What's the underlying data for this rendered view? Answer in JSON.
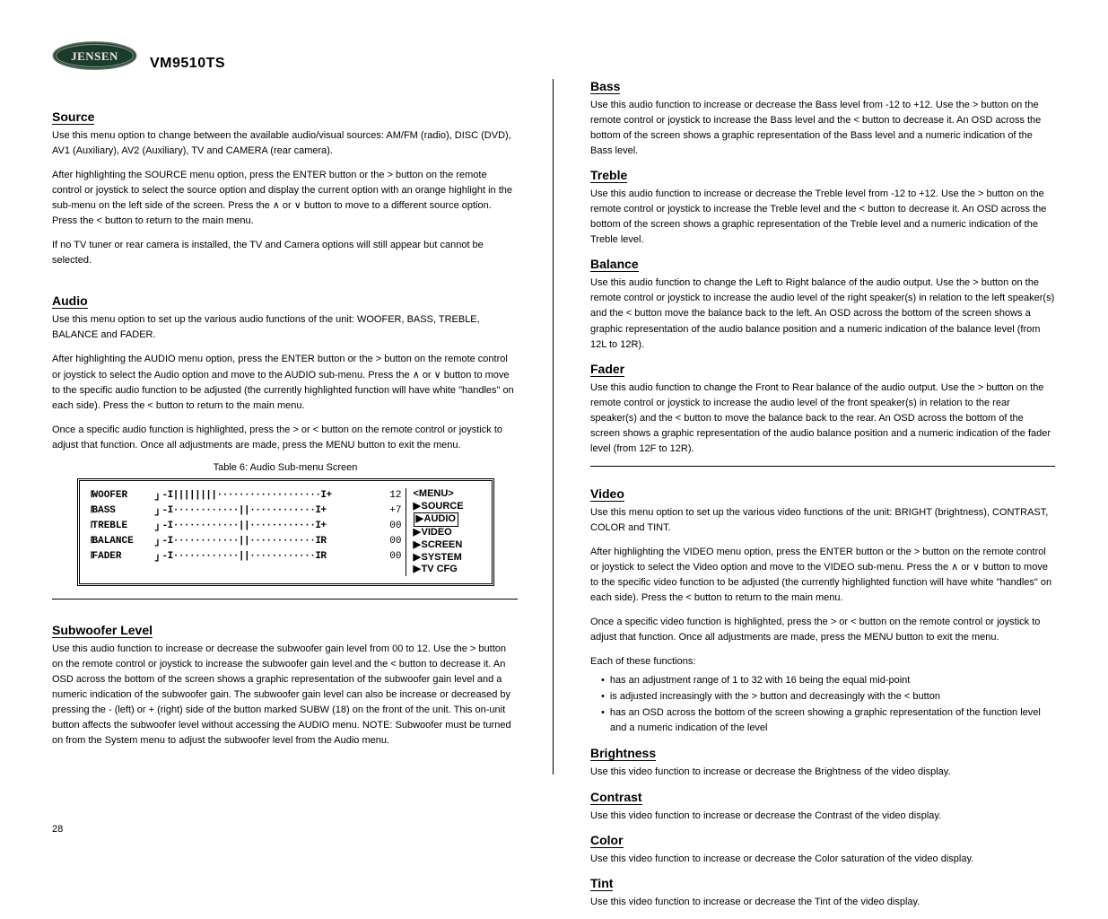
{
  "model": "VM9510TS",
  "page_number": "28",
  "left": {
    "source": {
      "title": "Source",
      "p1": "Use this menu option to change between the available audio/visual sources: AM/FM (radio), DISC (DVD), AV1 (Auxiliary), AV2 (Auxiliary), TV and CAMERA (rear camera).",
      "p2": "After highlighting the SOURCE menu option, press the ENTER button or the > button on the remote control or joystick to select the source option and display the current option with an orange highlight in the sub-menu on the left side of the screen. Press the ∧ or ∨ button to move to a different source option. Press the < button to return to the main menu.",
      "p3": "If no TV tuner or rear camera is installed, the TV and Camera options will still appear but cannot be selected."
    },
    "audio": {
      "title": "Audio",
      "p1": "Use this menu option to set up the various audio functions of the unit: WOOFER, BASS, TREBLE, BALANCE and FADER.",
      "p2": "After highlighting the AUDIO menu option, press the ENTER button or the > button on the remote control or joystick to select the Audio option and move to the AUDIO sub-menu. Press the ∧ or ∨ button to move to the specific audio function to be adjusted (the currently highlighted function will have white \"handles\" on each side). Press the < button to return to the main menu.",
      "p3": "Once a specific audio function is highlighted, press the > or < button on the remote control or joystick to adjust that function. Once all adjustments are made, press the MENU button to exit the menu.",
      "figure_label": "Table 6: Audio Sub-menu Screen"
    },
    "figure": {
      "rows": [
        {
          "label": "WOOFER",
          "track": "-I||||||||···················I+",
          "value": "12"
        },
        {
          "label": "BASS",
          "track": "-I············||············I+",
          "value": "+7"
        },
        {
          "label": "TREBLE",
          "track": "-I············||············I+",
          "value": "00"
        },
        {
          "label": "BALANCE",
          "track": "-I············||············IR",
          "value": "00"
        },
        {
          "label": "FADER",
          "track": "-I············||············IR",
          "value": "00"
        }
      ],
      "menu_title": "<MENU>",
      "menu_items": [
        "SOURCE",
        "AUDIO",
        "VIDEO",
        "SCREEN",
        "SYSTEM",
        "TV CFG"
      ],
      "menu_selected_index": 1
    },
    "woofer": {
      "title": "Subwoofer Level",
      "para": "Use this audio function to increase or decrease the subwoofer gain level from 00 to 12. Use the > button on the remote control or joystick to increase the subwoofer gain level and the < button to decrease it. An OSD across the bottom of the screen shows a graphic representation of the subwoofer gain level and a numeric indication of the subwoofer gain. The subwoofer gain level can also be increase or decreased by pressing the - (left) or + (right) side of the button marked SUBW (18) on the front of the unit. This on-unit button affects the subwoofer level without accessing the AUDIO menu. NOTE: Subwoofer must be turned on from the System menu to adjust the subwoofer level from the Audio menu."
    }
  },
  "right": {
    "bass": {
      "title": "Bass",
      "para": "Use this audio function to increase or decrease the Bass level from -12 to +12. Use the > button on the remote control or joystick to increase the Bass level and the < button to decrease it. An OSD across the bottom of the screen shows a graphic representation of the Bass level and a numeric indication of the Bass level."
    },
    "treble": {
      "title": "Treble",
      "para": "Use this audio function to increase or decrease the Treble level from -12 to +12. Use the > button on the remote control or joystick to increase the Treble level and the < button to decrease it. An OSD across the bottom of the screen shows a graphic representation of the Treble level and a numeric indication of the Treble level."
    },
    "balance": {
      "title": "Balance",
      "para": "Use this audio function to change the Left to Right balance of the audio output. Use the > button on the remote control or joystick to increase the audio level of the right speaker(s) in relation to the left speaker(s) and the < button move the balance back to the left. An OSD across the bottom of the screen shows a graphic representation of the audio balance position and a numeric indication of the balance level (from 12L to 12R)."
    },
    "fader": {
      "title": "Fader",
      "para": "Use this audio function to change the Front to Rear balance of the audio output. Use the > button on the remote control or joystick to increase the audio level of the front speaker(s) in relation to the rear speaker(s) and the < button to move the balance back to the rear. An OSD across the bottom of the screen shows a graphic representation of the audio balance position and a numeric indication of the fader level (from 12F to 12R)."
    },
    "video": {
      "title": "Video",
      "p1": "Use this menu option to set up the various video functions of the unit: BRIGHT (brightness), CONTRAST, COLOR and TINT.",
      "p2": "After highlighting the VIDEO menu option, press the ENTER button or the > button on the remote control or joystick to select the Video option and move to the VIDEO sub-menu. Press the ∧ or ∨ button to move to the specific video function to be adjusted (the currently highlighted function will have white \"handles\" on each side). Press the < button to return to the main menu.",
      "p3": "Once a specific video function is highlighted, press the > or < button on the remote control or joystick to adjust that function. Once all adjustments are made, press the MENU button to exit the menu.",
      "list_label": "Each of these functions:",
      "items": [
        "has an adjustment range of 1 to 32 with 16 being the equal mid-point",
        "is adjusted increasingly with the > button and decreasingly with the < button",
        "has an OSD across the bottom of the screen showing a graphic representation of the function level and a numeric indication of the level"
      ]
    },
    "brightness": {
      "title": "Brightness",
      "para": "Use this video function to increase or decrease the Brightness of the video display."
    },
    "contrast": {
      "title": "Contrast",
      "para": "Use this video function to increase or decrease the Contrast of the video display."
    },
    "color": {
      "title": "Color",
      "para": "Use this video function to increase or decrease the Color saturation of the video display."
    },
    "tint": {
      "title": "Tint",
      "para": "Use this video function to increase or decrease the Tint of the video display."
    }
  }
}
